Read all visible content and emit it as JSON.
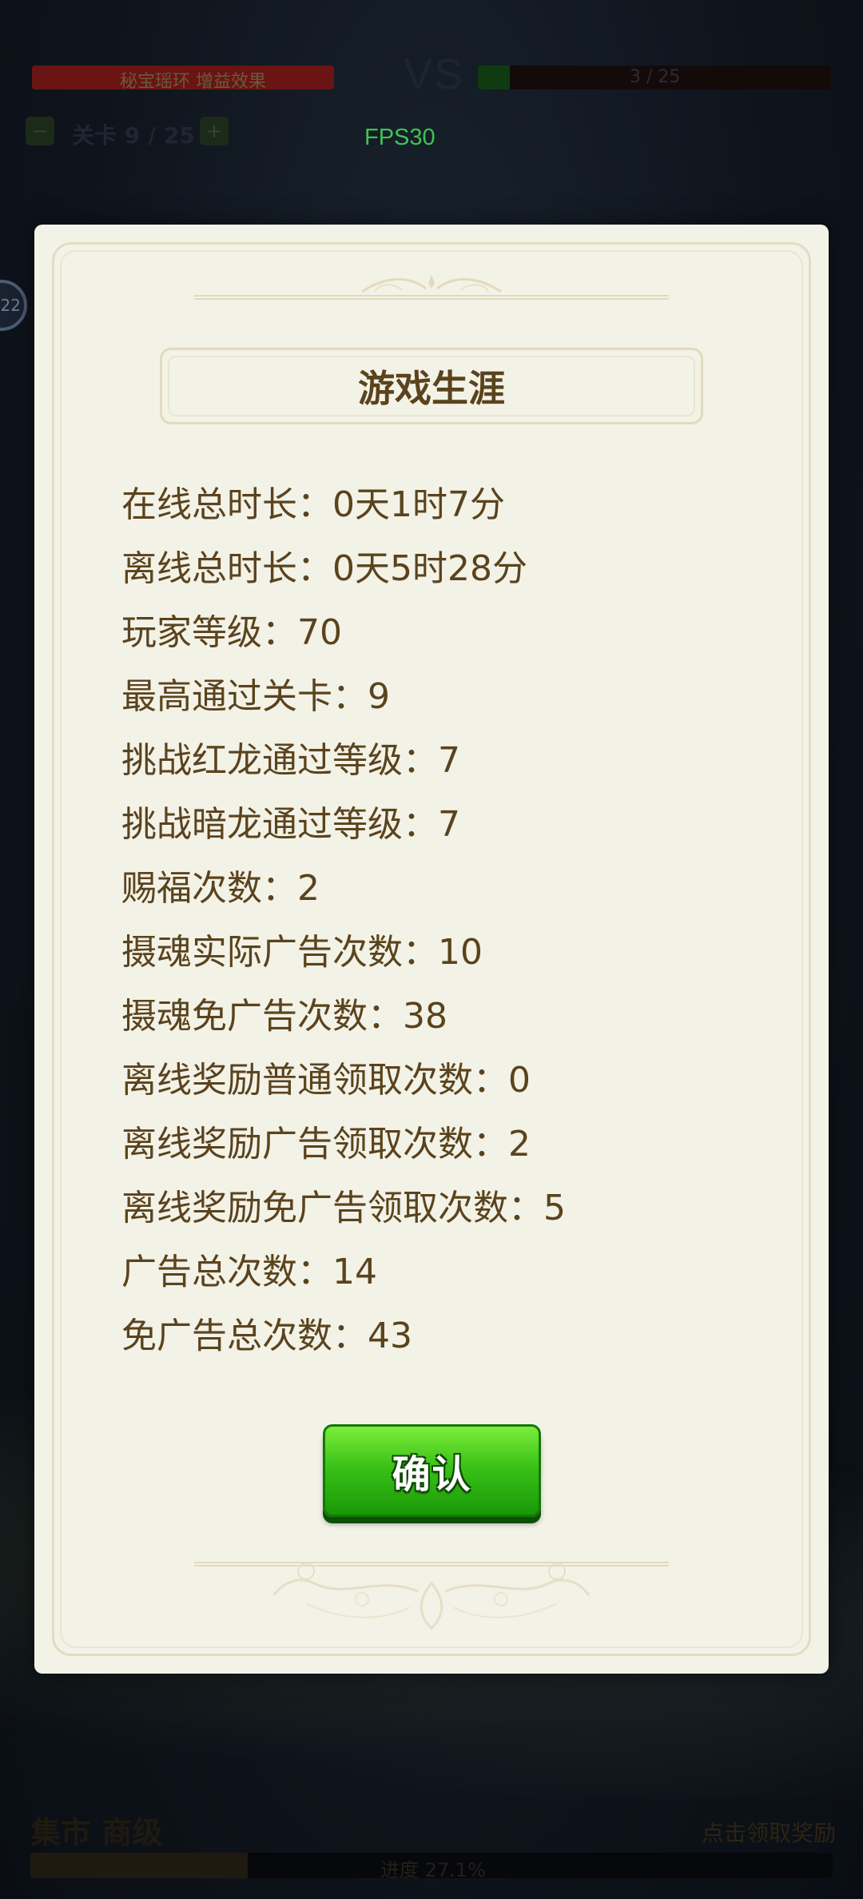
{
  "hud": {
    "left_bar_text": "秘宝瑶环 增益效果",
    "left_bar_fill": 1.0,
    "vs_text": "VS",
    "right_bar_text": "3 / 25",
    "right_bar_fill": 0.09,
    "stage_text": "关卡 9 / 25",
    "fps_text": "FPS30",
    "side_badge": "22",
    "bottom_title": "集市 商级",
    "bottom_right_text": "点击领取奖励",
    "bottom_progress_text": "进度 27.1%",
    "bottom_progress_fill": 0.271
  },
  "dialog": {
    "title": "游戏生涯",
    "stats": [
      "在线总时长：0天1时7分",
      "离线总时长：0天5时28分",
      "玩家等级：70",
      "最高通过关卡：9",
      "挑战红龙通过等级：7",
      "挑战暗龙通过等级：7",
      "赐福次数：2",
      "摄魂实际广告次数：10",
      "摄魂免广告次数：38",
      "离线奖励普通领取次数：0",
      "离线奖励广告领取次数：2",
      "离线奖励免广告领取次数：5",
      "广告总次数：14",
      "免广告总次数：43"
    ],
    "confirm_label": "确认"
  },
  "colors": {
    "dialog_bg": "#f3f2e7",
    "text_brown": "#5a431d",
    "button_green": "#3bc218",
    "fps_green": "#3cc552"
  }
}
